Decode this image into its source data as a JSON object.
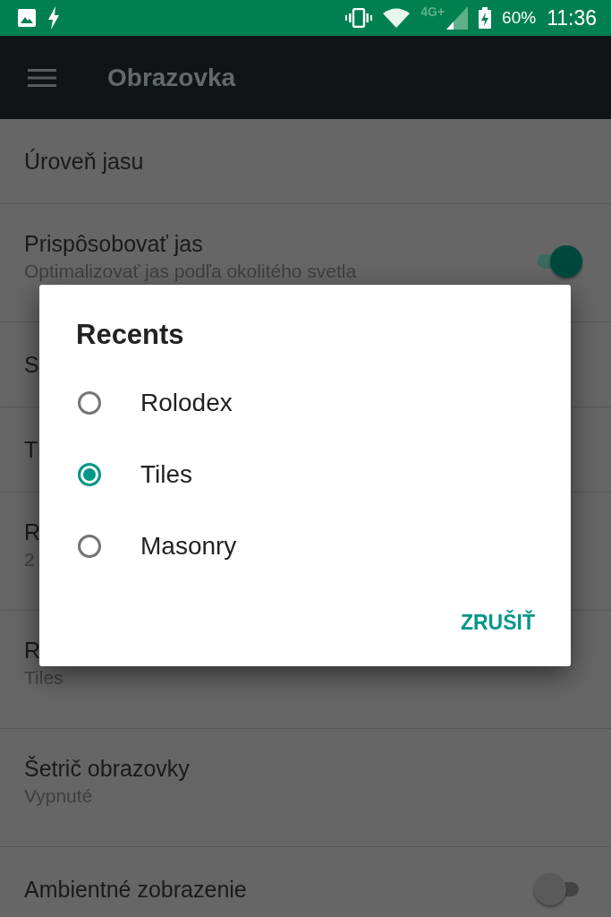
{
  "status_bar": {
    "network": "4G+",
    "battery": "60%",
    "time": "11:36"
  },
  "toolbar": {
    "title": "Obrazovka"
  },
  "settings": [
    {
      "title": "Úroveň jasu"
    },
    {
      "title": "Prispôsobovať jas",
      "subtitle": "Optimalizovať jas podľa okolitého svetla",
      "switch": {
        "on": true
      }
    },
    {
      "title": "S"
    },
    {
      "title": "T"
    },
    {
      "title": "R",
      "subtitle": "2"
    },
    {
      "title": "R",
      "subtitle": "Tiles"
    },
    {
      "title": "Šetrič obrazovky",
      "subtitle": "Vypnuté"
    },
    {
      "title": "Ambientné zobrazenie",
      "switch": {
        "on": false
      }
    }
  ],
  "dialog": {
    "title": "Recents",
    "options": [
      {
        "label": "Rolodex",
        "selected": false
      },
      {
        "label": "Tiles",
        "selected": true
      },
      {
        "label": "Masonry",
        "selected": false
      }
    ],
    "buttons": [
      "ZRUŠIŤ"
    ]
  }
}
